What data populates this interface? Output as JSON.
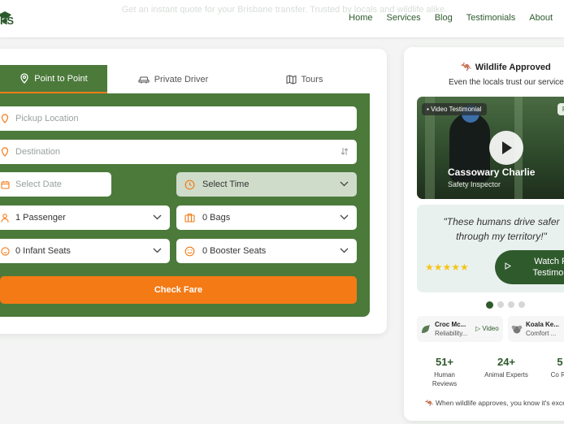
{
  "header": {
    "logo_text": "RS",
    "tagline": "Get an instant quote for your Brisbane transfer. Trusted by locals and wildlife alike.",
    "nav": [
      "Home",
      "Services",
      "Blog",
      "Testimonials",
      "About"
    ]
  },
  "booking": {
    "tabs": [
      {
        "label": "Point to Point",
        "icon": "map-pin-icon",
        "active": true
      },
      {
        "label": "Private Driver",
        "icon": "car-icon",
        "active": false
      },
      {
        "label": "Tours",
        "icon": "map-icon",
        "active": false
      }
    ],
    "pickup_placeholder": "Pickup Location",
    "destination_placeholder": "Destination",
    "date_placeholder": "Select Date",
    "time_value": "Select Time",
    "passengers_value": "1 Passenger",
    "bags_value": "0 Bags",
    "infant_value": "0 Infant Seats",
    "booster_value": "0 Booster Seats",
    "check_fare_label": "Check Fare",
    "colors": {
      "green": "#4b7a3a",
      "orange": "#f47a16"
    }
  },
  "reviews": {
    "title": "Wildlife Approved",
    "subtitle": "Even the locals trust our service!",
    "video_badge": "Video Testimonial",
    "video_badge_right": "Road",
    "reviewer_name": "Cassowary Charlie",
    "reviewer_role": "Safety Inspector",
    "quote": "\"These humans drive safer through my territory!\"",
    "stars": "★★★★★",
    "watch_label": "Watch Full Testimonial",
    "mini": [
      {
        "name": "Croc Mc...",
        "role": "Reliability...",
        "video": "Video"
      },
      {
        "name": "Koala Ke...",
        "role": "Comfort ..."
      }
    ],
    "stats": [
      {
        "num": "51+",
        "label": "Human Reviews"
      },
      {
        "num": "24+",
        "label": "Animal Experts"
      },
      {
        "num": "5",
        "label": "Co Ra"
      }
    ],
    "footer": "When wildlife approves, you know it's exce"
  }
}
